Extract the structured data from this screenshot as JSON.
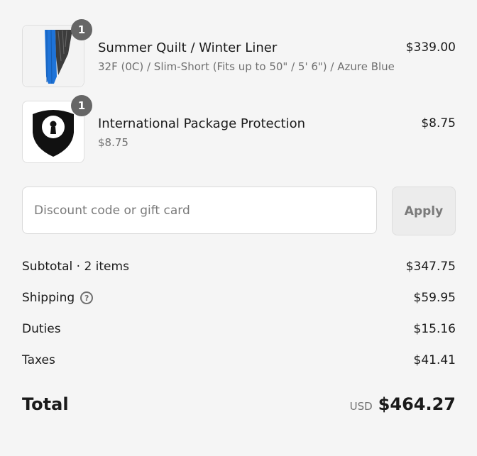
{
  "line_items": [
    {
      "title": "Summer Quilt / Winter Liner",
      "variant": "32F (0C) / Slim-Short (Fits up to 50\" / 5' 6\") / Azure Blue",
      "price": "$339.00",
      "quantity": "1",
      "image_icon": "quilt-product-image"
    },
    {
      "title": "International Package Protection",
      "variant": "$8.75",
      "price": "$8.75",
      "quantity": "1",
      "image_icon": "shield-keyhole-icon"
    }
  ],
  "discount": {
    "placeholder": "Discount code or gift card",
    "value": "",
    "apply_label": "Apply"
  },
  "summary": {
    "subtotal_label": "Subtotal · 2 items",
    "subtotal_value": "$347.75",
    "shipping_label": "Shipping",
    "shipping_value": "$59.95",
    "duties_label": "Duties",
    "duties_value": "$15.16",
    "taxes_label": "Taxes",
    "taxes_value": "$41.41",
    "help_icon": "question-circle-icon"
  },
  "total": {
    "label": "Total",
    "currency": "USD",
    "amount": "$464.27"
  },
  "colors": {
    "background": "#f5f5f5",
    "badge": "#666666",
    "quilt_blue": "#1e73d8"
  }
}
